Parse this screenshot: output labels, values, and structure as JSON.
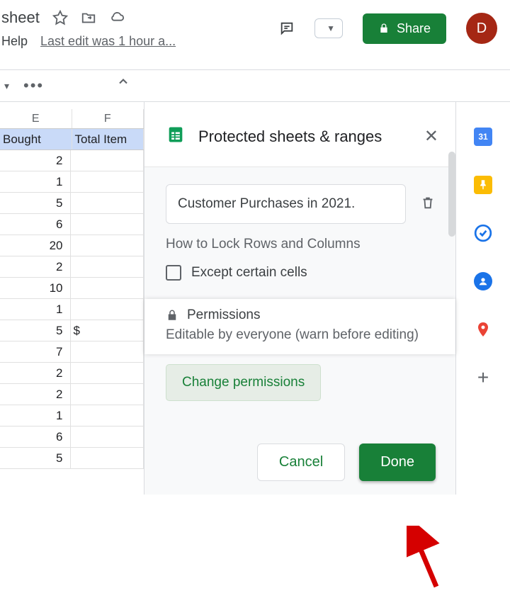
{
  "header": {
    "doc_title": "sheet",
    "menu_help": "Help",
    "last_edit": "Last edit was 1 hour a...",
    "share_label": "Share",
    "avatar_initial": "D"
  },
  "sheet": {
    "col_e": "E",
    "col_f": "F",
    "head_e": "Bought",
    "head_f": "Total Item",
    "rows": [
      {
        "e": "2",
        "f": ""
      },
      {
        "e": "1",
        "f": ""
      },
      {
        "e": "5",
        "f": ""
      },
      {
        "e": "6",
        "f": ""
      },
      {
        "e": "20",
        "f": ""
      },
      {
        "e": "2",
        "f": ""
      },
      {
        "e": "10",
        "f": ""
      },
      {
        "e": "1",
        "f": ""
      },
      {
        "e": "5",
        "f": "$"
      },
      {
        "e": "7",
        "f": ""
      },
      {
        "e": "2",
        "f": ""
      },
      {
        "e": "2",
        "f": ""
      },
      {
        "e": "1",
        "f": ""
      },
      {
        "e": "6",
        "f": ""
      },
      {
        "e": "5",
        "f": ""
      }
    ]
  },
  "panel": {
    "title": "Protected sheets & ranges",
    "description_value": "Customer Purchases in 2021.",
    "sheet_name": "How to Lock Rows and Columns",
    "except_label": "Except certain cells",
    "permissions_title": "Permissions",
    "permissions_sub": "Editable by everyone (warn before editing)",
    "change_label": "Change permissions",
    "cancel_label": "Cancel",
    "done_label": "Done"
  },
  "rail": {
    "calendar_day": "31"
  }
}
